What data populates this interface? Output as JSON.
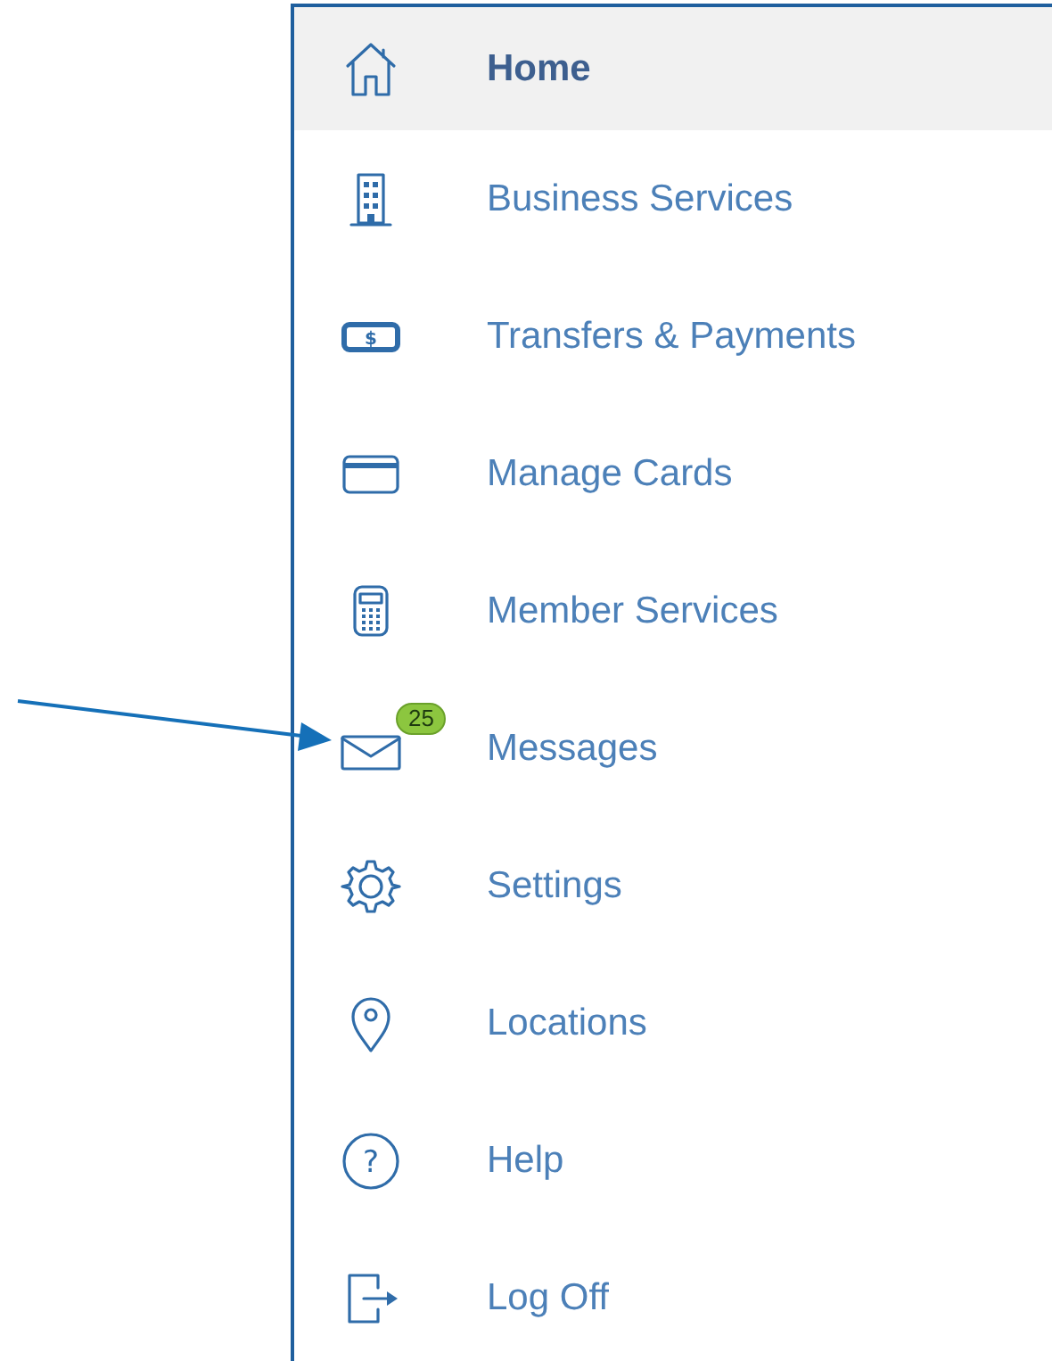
{
  "menu": {
    "items": [
      {
        "label": "Home",
        "selected": true
      },
      {
        "label": "Business Services",
        "selected": false
      },
      {
        "label": "Transfers & Payments",
        "selected": false,
        "icon_glyph": "$"
      },
      {
        "label": "Manage Cards",
        "selected": false
      },
      {
        "label": "Member Services",
        "selected": false
      },
      {
        "label": "Messages",
        "selected": false,
        "badge": "25"
      },
      {
        "label": "Settings",
        "selected": false
      },
      {
        "label": "Locations",
        "selected": false
      },
      {
        "label": "Help",
        "selected": false,
        "icon_glyph": "?"
      },
      {
        "label": "Log Off",
        "selected": false
      }
    ]
  }
}
